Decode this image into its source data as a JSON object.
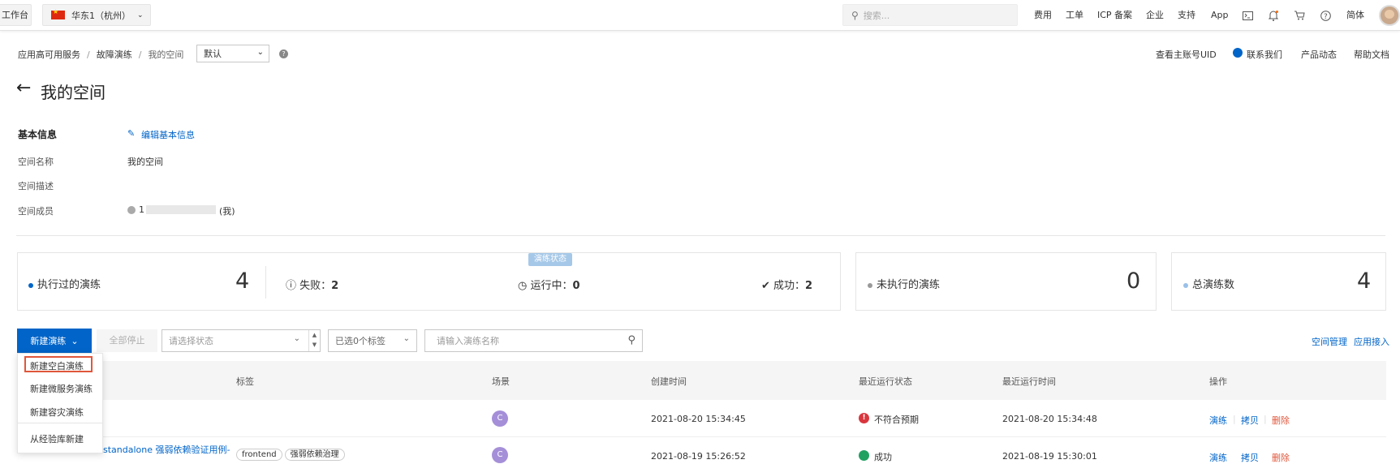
{
  "topbar": {
    "workbench": "工作台",
    "region": "华东1（杭州）",
    "search_placeholder": "搜索...",
    "nav": [
      "费用",
      "工单",
      "ICP 备案",
      "企业",
      "支持",
      "App"
    ],
    "lang": "简体"
  },
  "breadcrumb": [
    "应用高可用服务",
    "故障演练",
    "我的空间"
  ],
  "breadcrumb_sep": "/",
  "env_select": "默认",
  "header_links": [
    "查看主账号UID",
    "联系我们",
    "产品动态",
    "帮助文档"
  ],
  "page_title": "我的空间",
  "basic_info": {
    "title": "基本信息",
    "edit": "编辑基本信息",
    "labels": [
      "空间名称",
      "空间描述",
      "空间成员"
    ],
    "space_name": "我的空间",
    "member_prefix": "1",
    "member_suffix": "(我)"
  },
  "stats": {
    "badge": "演练状态",
    "executed_label": "执行过的演练",
    "executed": "4",
    "failed_label": "失败：",
    "failed": "2",
    "running_label": "运行中：",
    "running": "0",
    "success_label": "成功：",
    "success": "2",
    "not_executed_label": "未执行的演练",
    "not_executed": "0",
    "total_label": "总演练数",
    "total": "4"
  },
  "toolbar": {
    "new_drill": "新建演练",
    "stop_all": "全部停止",
    "status_placeholder": "请选择状态",
    "tags_select": "已选0个标签",
    "name_placeholder": "请输入演练名称",
    "space_manage": "空间管理",
    "app_access": "应用接入"
  },
  "dropdown": [
    "新建空白演练",
    "新建微服务演练",
    "新建容灾演练",
    "从经验库新建"
  ],
  "table": {
    "headers": [
      "标签",
      "场景",
      "创建时间",
      "最近运行状态",
      "最近运行时间",
      "操作"
    ],
    "rows": [
      {
        "name": "",
        "tags": [],
        "scene": "C",
        "created": "2021-08-20 15:34:45",
        "status": "不符合预期",
        "last_run": "2021-08-20 15:34:48"
      },
      {
        "name": "standalone 强弱依赖验证用例-",
        "tags": [
          "frontend",
          "强弱依赖治理"
        ],
        "scene": "C",
        "created": "2021-08-19 15:26:52",
        "status": "成功",
        "last_run": "2021-08-19 15:30:01"
      }
    ],
    "actions": [
      "演练",
      "拷贝",
      "删除"
    ]
  },
  "colors": {
    "primary": "#0064c8",
    "danger": "#e0573c",
    "success": "#20a162",
    "scene": "#a58fd8"
  }
}
